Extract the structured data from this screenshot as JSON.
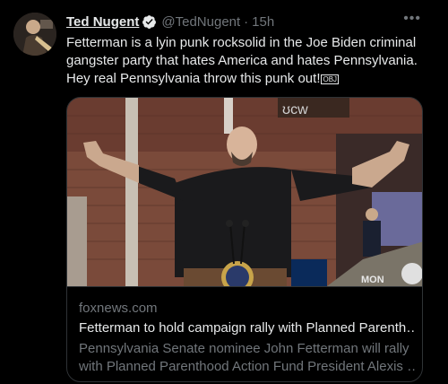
{
  "tweet": {
    "display_name": "Ted Nugent",
    "handle": "@TedNugent",
    "separator": "·",
    "time": "15h",
    "more_label": "•••",
    "text": "Fetterman is a lyin punk rocksolid in the Joe Biden criminal gangster party that hates America and hates Pennsylvania. Hey real Pennsylvania throw this punk out!",
    "text_symbol": "OBJ"
  },
  "card": {
    "domain": "foxnews.com",
    "title": "Fetterman to hold campaign rally with Planned Parenth…",
    "desc_line1": "Pennsylvania Senate nominee John Fetterman will rally",
    "desc_line2": "with Planned Parenthood Action Fund President Alexis …",
    "photo_sign_text": "MON"
  },
  "colors": {
    "background": "#000000",
    "text": "#e7e9ea",
    "secondary": "#71767b",
    "verified": "#1d9bf0",
    "border": "#2f3336"
  }
}
